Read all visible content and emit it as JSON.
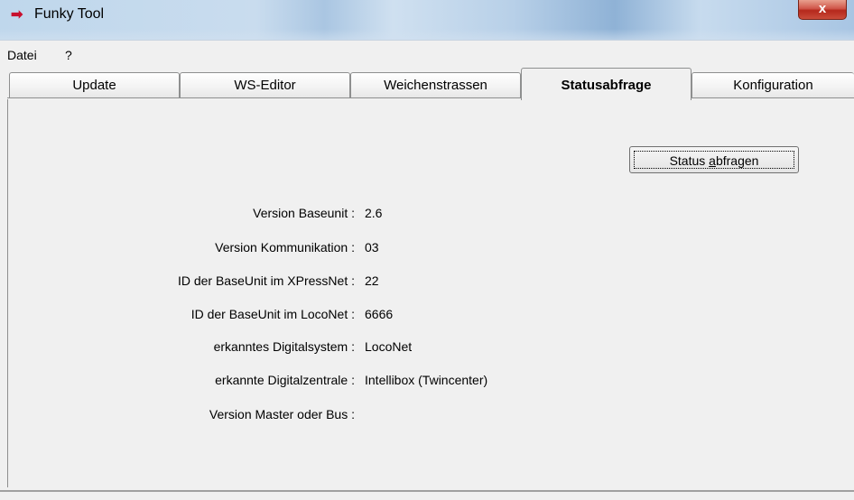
{
  "window": {
    "title": "Funky Tool",
    "close_glyph": "x"
  },
  "menu": {
    "items": [
      "Datei",
      "?"
    ]
  },
  "tabs": [
    "Update",
    "WS-Editor",
    "Weichenstrassen",
    "Statusabfrage",
    "Konfiguration"
  ],
  "active_tab": "Statusabfrage",
  "button": {
    "prefix": "Status ",
    "underlined": "a",
    "suffix": "bfragen"
  },
  "status": [
    {
      "label": "Version Baseunit :",
      "value": "2.6"
    },
    {
      "label": "Version Kommunikation :",
      "value": "03"
    },
    {
      "label": "ID der BaseUnit im XPressNet :",
      "value": "22"
    },
    {
      "label": "ID der BaseUnit im LocoNet :",
      "value": "6666"
    },
    {
      "label": "erkanntes Digitalsystem :",
      "value": "LocoNet"
    },
    {
      "label": "erkannte Digitalzentrale :",
      "value": "Intellibox (Twincenter)"
    },
    {
      "label": "Version Master oder Bus :",
      "value": ""
    }
  ],
  "colors": {
    "accent": "#c8102e",
    "close": "#c94b3a"
  }
}
